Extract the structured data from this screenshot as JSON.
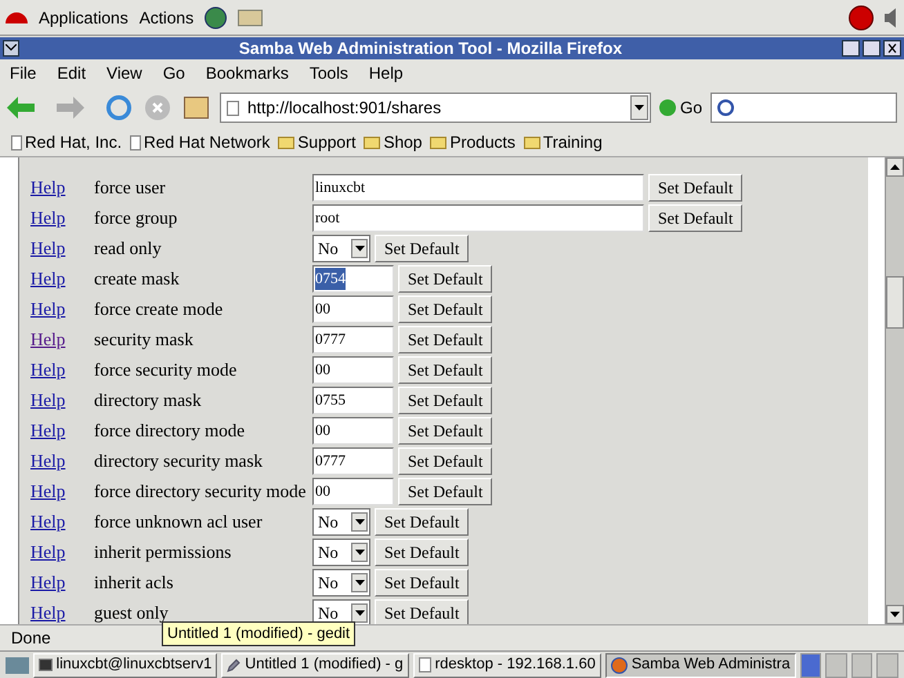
{
  "top_panel": {
    "menus": [
      "Applications",
      "Actions"
    ]
  },
  "window": {
    "title": "Samba Web Administration Tool - Mozilla Firefox"
  },
  "menu_bar": [
    "File",
    "Edit",
    "View",
    "Go",
    "Bookmarks",
    "Tools",
    "Help"
  ],
  "toolbar": {
    "url": "http://localhost:901/shares",
    "go": "Go"
  },
  "bookmarks": [
    {
      "label": "Red Hat, Inc.",
      "kind": "page"
    },
    {
      "label": "Red Hat Network",
      "kind": "page"
    },
    {
      "label": "Support",
      "kind": "folder"
    },
    {
      "label": "Shop",
      "kind": "folder"
    },
    {
      "label": "Products",
      "kind": "folder"
    },
    {
      "label": "Training",
      "kind": "folder"
    }
  ],
  "parameters": [
    {
      "help": "Help",
      "name": "force user",
      "kind": "wide",
      "value": "linuxcbt",
      "button": "Set Default",
      "visited": false
    },
    {
      "help": "Help",
      "name": "force group",
      "kind": "wide",
      "value": "root",
      "button": "Set Default",
      "visited": false
    },
    {
      "help": "Help",
      "name": "read only",
      "kind": "select",
      "value": "No",
      "button": "Set Default",
      "visited": false
    },
    {
      "help": "Help",
      "name": "create mask",
      "kind": "text",
      "value": "0754",
      "button": "Set Default",
      "visited": false,
      "value_selected": true
    },
    {
      "help": "Help",
      "name": "force create mode",
      "kind": "text",
      "value": "00",
      "button": "Set Default",
      "visited": false,
      "value_selected": false
    },
    {
      "help": "Help",
      "name": "security mask",
      "kind": "text",
      "value": "0777",
      "button": "Set Default",
      "visited": true,
      "value_selected": false
    },
    {
      "help": "Help",
      "name": "force security mode",
      "kind": "text",
      "value": "00",
      "button": "Set Default",
      "visited": false,
      "value_selected": false
    },
    {
      "help": "Help",
      "name": "directory mask",
      "kind": "text",
      "value": "0755",
      "button": "Set Default",
      "visited": false,
      "value_selected": false
    },
    {
      "help": "Help",
      "name": "force directory mode",
      "kind": "text",
      "value": "00",
      "button": "Set Default",
      "visited": false,
      "value_selected": false
    },
    {
      "help": "Help",
      "name": "directory security mask",
      "kind": "text",
      "value": "0777",
      "button": "Set Default",
      "visited": false,
      "value_selected": false
    },
    {
      "help": "Help",
      "name": "force directory security mode",
      "kind": "text",
      "value": "00",
      "button": "Set Default",
      "visited": false,
      "value_selected": false
    },
    {
      "help": "Help",
      "name": "force unknown acl user",
      "kind": "select",
      "value": "No",
      "button": "Set Default",
      "visited": false
    },
    {
      "help": "Help",
      "name": "inherit permissions",
      "kind": "select",
      "value": "No",
      "button": "Set Default",
      "visited": false
    },
    {
      "help": "Help",
      "name": "inherit acls",
      "kind": "select",
      "value": "No",
      "button": "Set Default",
      "visited": false
    },
    {
      "help": "Help",
      "name": "guest only",
      "kind": "select",
      "value": "No",
      "button": "Set Default",
      "visited": false
    }
  ],
  "status_bar": {
    "text": "Done"
  },
  "tooltip": "Untitled 1 (modified) - gedit",
  "taskbar": [
    {
      "label": "linuxcbt@linuxcbtserv1",
      "kind": "terminal",
      "selected": false
    },
    {
      "label": "Untitled 1 (modified) - g",
      "kind": "editor",
      "selected": false
    },
    {
      "label": "rdesktop - 192.168.1.60",
      "kind": "page",
      "selected": false
    },
    {
      "label": "Samba Web Administra",
      "kind": "browser",
      "selected": true
    }
  ],
  "workspaces": [
    {
      "selected": true
    },
    {
      "selected": false
    },
    {
      "selected": false
    },
    {
      "selected": false
    }
  ]
}
